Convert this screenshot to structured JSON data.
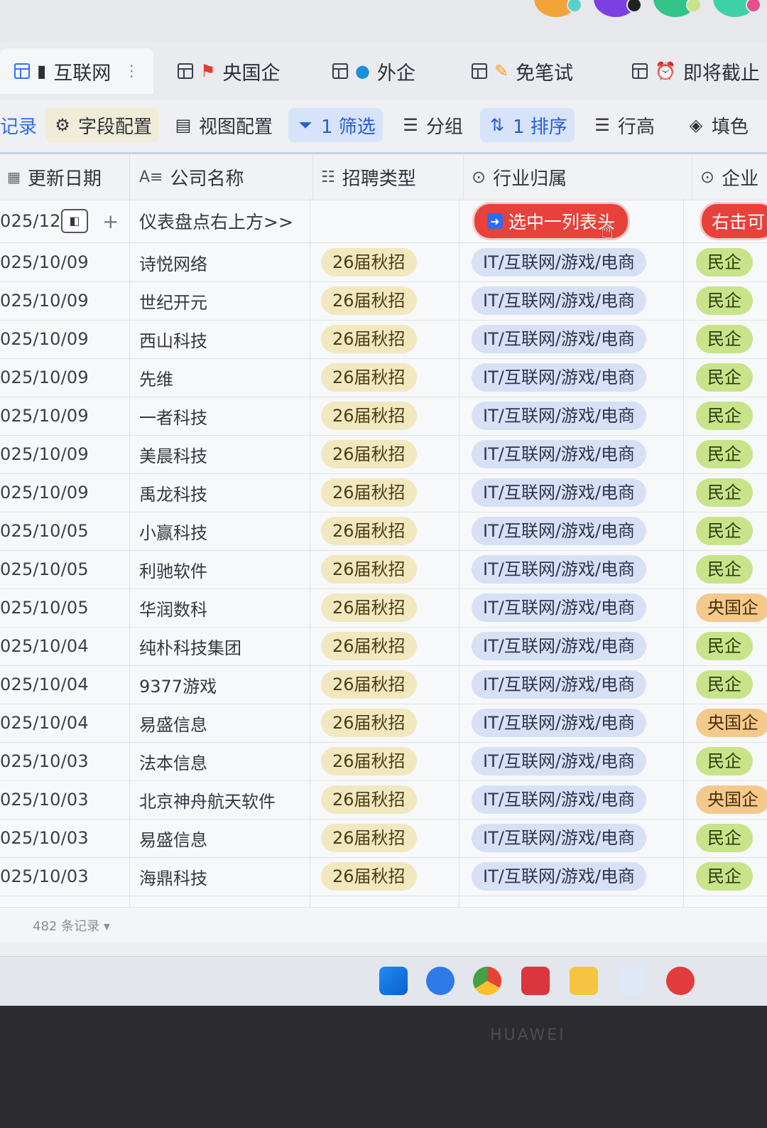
{
  "tabs": [
    {
      "label": "互联网",
      "icon": "building-icon"
    },
    {
      "label": "央国企",
      "icon": "red-flag-icon"
    },
    {
      "label": "外企",
      "icon": "globe-icon"
    },
    {
      "label": "免笔试",
      "icon": "pencil-icon"
    },
    {
      "label": "即将截止",
      "icon": "alarm-icon"
    }
  ],
  "toolbar": {
    "records": "记录",
    "field_config": "字段配置",
    "view_config": "视图配置",
    "filter": "1 筛选",
    "group": "分组",
    "sort": "1 排序",
    "row_height": "行高",
    "fill_color": "填色"
  },
  "columns": {
    "update_date": "更新日期",
    "company": "公司名称",
    "recruit_type": "招聘类型",
    "industry": "行业归属",
    "company_type": "企业"
  },
  "first_row": {
    "date": "025/12/",
    "note": "仪表盘点右上方>>",
    "hint_pill": "选中一列表头",
    "right_pill": "右击可"
  },
  "rows": [
    {
      "date": "025/10/09",
      "company": "诗悦网络",
      "type": "26届秋招",
      "industry": "IT/互联网/游戏/电商",
      "kind": "民企"
    },
    {
      "date": "025/10/09",
      "company": "世纪开元",
      "type": "26届秋招",
      "industry": "IT/互联网/游戏/电商",
      "kind": "民企"
    },
    {
      "date": "025/10/09",
      "company": "西山科技",
      "type": "26届秋招",
      "industry": "IT/互联网/游戏/电商",
      "kind": "民企"
    },
    {
      "date": "025/10/09",
      "company": "先维",
      "type": "26届秋招",
      "industry": "IT/互联网/游戏/电商",
      "kind": "民企"
    },
    {
      "date": "025/10/09",
      "company": "一者科技",
      "type": "26届秋招",
      "industry": "IT/互联网/游戏/电商",
      "kind": "民企"
    },
    {
      "date": "025/10/09",
      "company": "美晨科技",
      "type": "26届秋招",
      "industry": "IT/互联网/游戏/电商",
      "kind": "民企"
    },
    {
      "date": "025/10/09",
      "company": "禹龙科技",
      "type": "26届秋招",
      "industry": "IT/互联网/游戏/电商",
      "kind": "民企"
    },
    {
      "date": "025/10/05",
      "company": "小赢科技",
      "type": "26届秋招",
      "industry": "IT/互联网/游戏/电商",
      "kind": "民企"
    },
    {
      "date": "025/10/05",
      "company": "利驰软件",
      "type": "26届秋招",
      "industry": "IT/互联网/游戏/电商",
      "kind": "民企"
    },
    {
      "date": "025/10/05",
      "company": "华润数科",
      "type": "26届秋招",
      "industry": "IT/互联网/游戏/电商",
      "kind": "央国企"
    },
    {
      "date": "025/10/04",
      "company": "纯朴科技集团",
      "type": "26届秋招",
      "industry": "IT/互联网/游戏/电商",
      "kind": "民企"
    },
    {
      "date": "025/10/04",
      "company": "9377游戏",
      "type": "26届秋招",
      "industry": "IT/互联网/游戏/电商",
      "kind": "民企"
    },
    {
      "date": "025/10/04",
      "company": "易盛信息",
      "type": "26届秋招",
      "industry": "IT/互联网/游戏/电商",
      "kind": "央国企"
    },
    {
      "date": "025/10/03",
      "company": "法本信息",
      "type": "26届秋招",
      "industry": "IT/互联网/游戏/电商",
      "kind": "民企"
    },
    {
      "date": "025/10/03",
      "company": "北京神舟航天软件",
      "type": "26届秋招",
      "industry": "IT/互联网/游戏/电商",
      "kind": "央国企"
    },
    {
      "date": "025/10/03",
      "company": "易盛信息",
      "type": "26届秋招",
      "industry": "IT/互联网/游戏/电商",
      "kind": "民企"
    },
    {
      "date": "025/10/03",
      "company": "海鼎科技",
      "type": "26届秋招",
      "industry": "IT/互联网/游戏/电商",
      "kind": "民企"
    }
  ],
  "footer": {
    "record_count": "482 条记录"
  },
  "taskbar_apps": [
    "windows-start-icon",
    "edge-browser-icon",
    "chrome-icon",
    "app-red-icon",
    "file-explorer-icon",
    "lightning-app-icon",
    "netease-music-icon"
  ],
  "device_label": "HUAWEI",
  "colors": {
    "accent": "#3370ff",
    "campus_tag": "#f2e8bf",
    "industry_tag": "#d8e0f5",
    "private_tag": "#c9e38a",
    "soe_tag": "#f3c98c",
    "hint_pill": "#e8403a"
  }
}
